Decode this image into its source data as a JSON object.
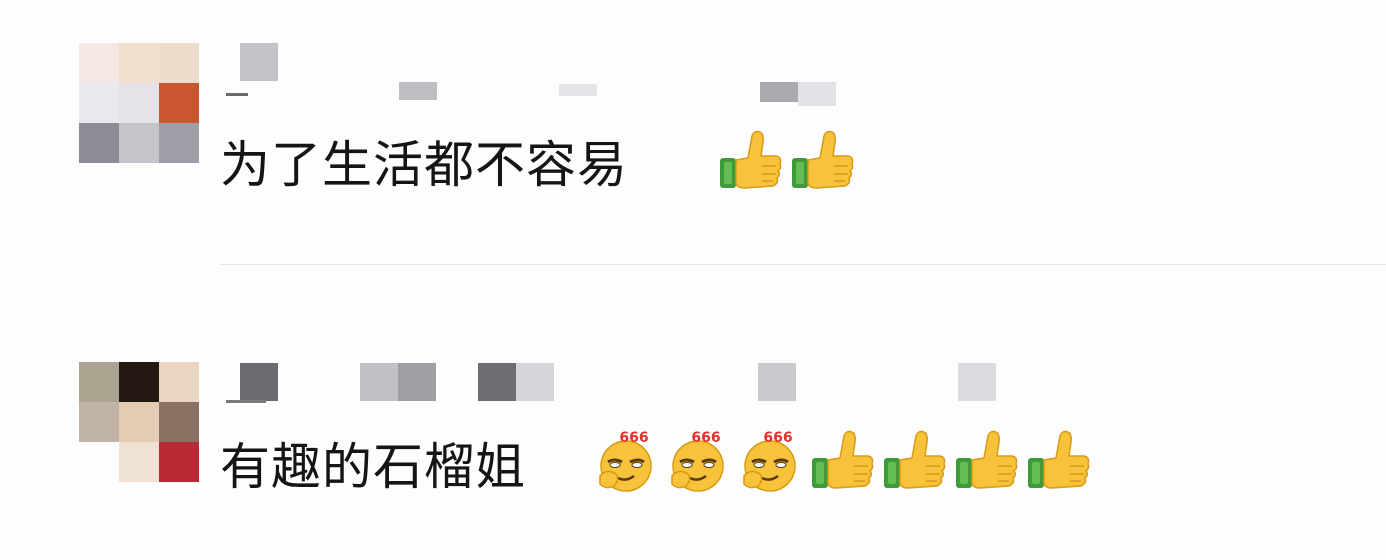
{
  "comments": [
    {
      "text": "为了生活都不容易",
      "emojis": [
        "thumbs-up-icon",
        "thumbs-up-icon"
      ]
    },
    {
      "text": "有趣的石榴姐",
      "emojis": [
        "smirk-666-icon",
        "smirk-666-icon",
        "smirk-666-icon",
        "thumbs-up-icon",
        "thumbs-up-icon",
        "thumbs-up-icon",
        "thumbs-up-icon"
      ]
    }
  ],
  "emoji_badge": "666",
  "colors": {
    "background": "#fdfdfe",
    "text": "#151515",
    "divider": "#e8e8ec",
    "thumb_yellow": "#f6c33a",
    "cuff_green": "#3f9a3a",
    "badge_red": "#e0332d"
  }
}
